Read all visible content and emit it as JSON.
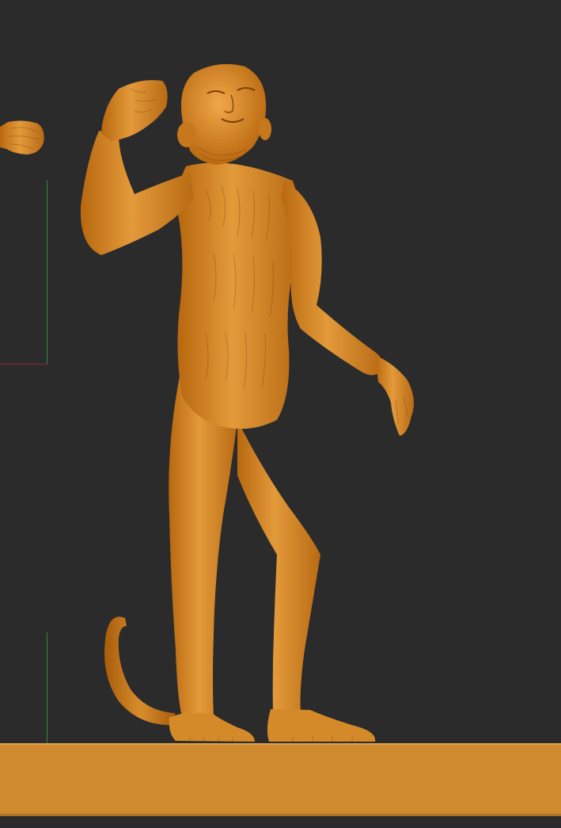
{
  "viewport": {
    "background_color": "#2b2b2b",
    "material_color": "#d2831f",
    "floor_color": "#d08a2f",
    "axis_x_color": "#8a2a2a",
    "axis_y_color": "#2f8a3a"
  },
  "scene": {
    "objects": [
      {
        "name": "monkey-sculpt",
        "selected": true
      },
      {
        "name": "partial-fist-offscreen",
        "selected": false
      },
      {
        "name": "base-floor-slab",
        "selected": false
      }
    ]
  }
}
